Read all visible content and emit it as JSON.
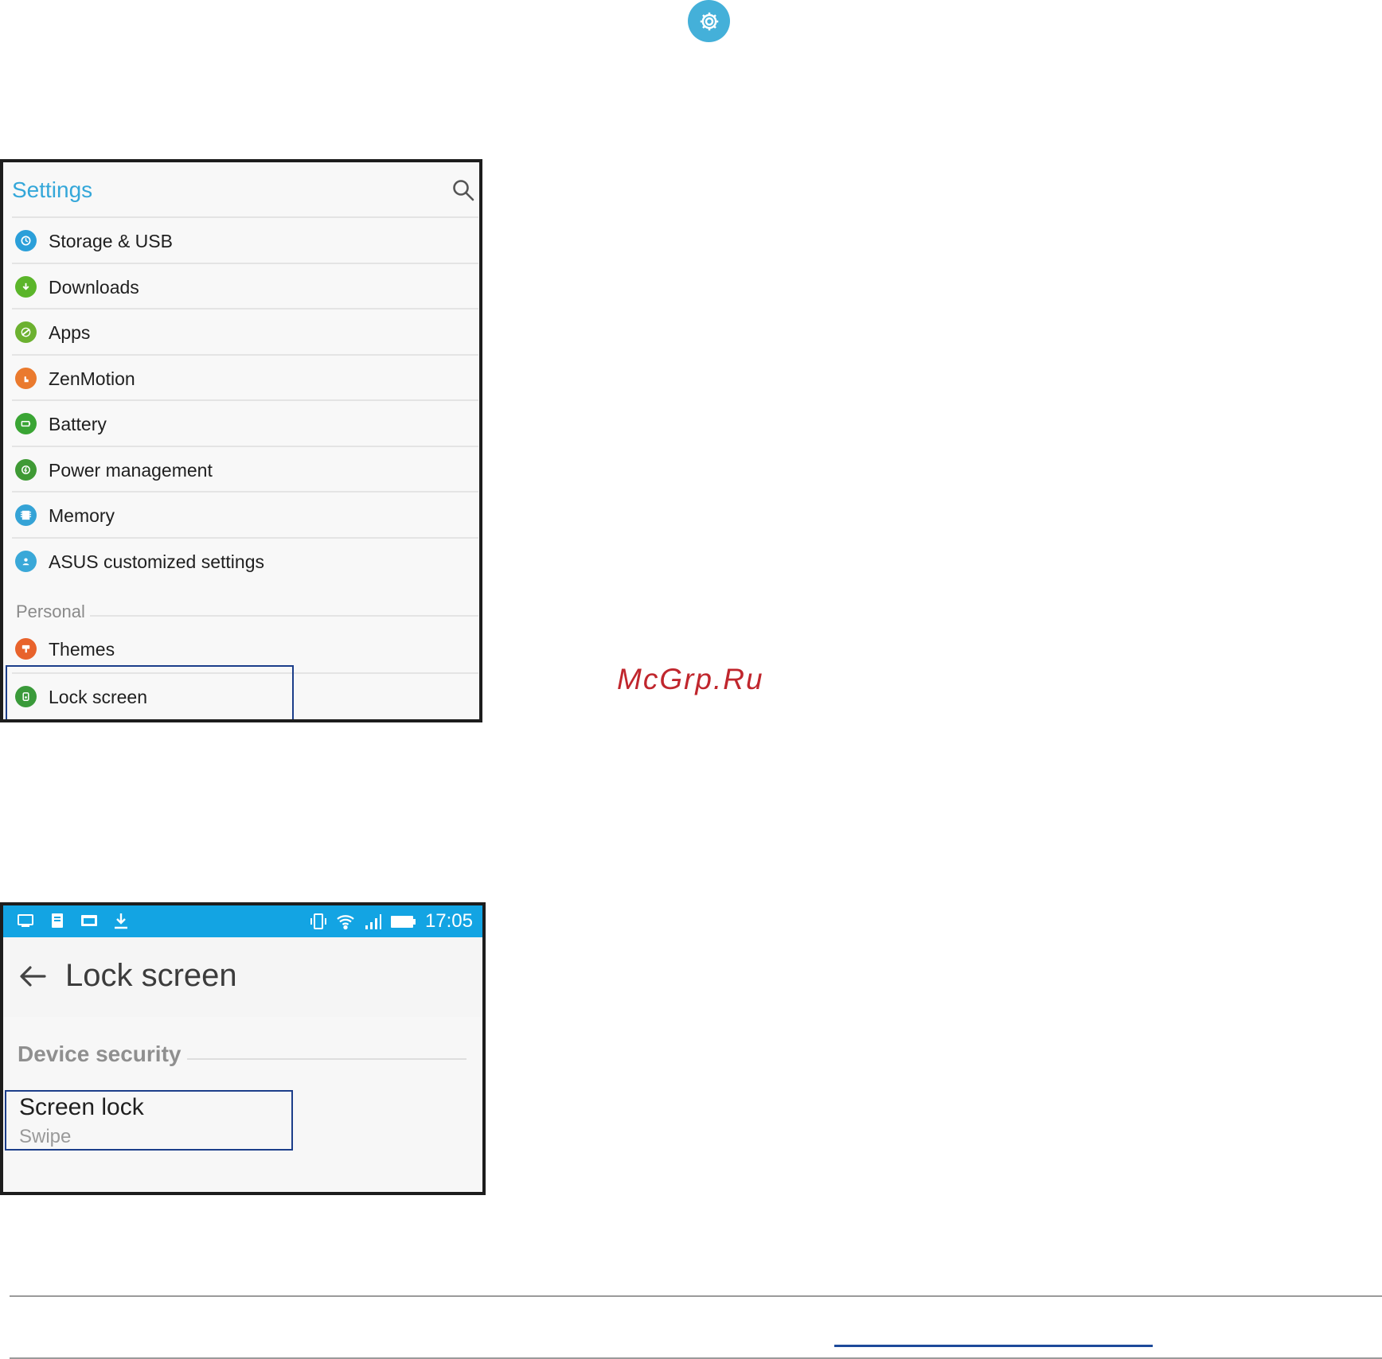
{
  "colors": {
    "accent": "#2ba8df",
    "gear_badge": "#44b0d9",
    "settings_title": "#34a7d9",
    "highlight_border": "#1c3e8a",
    "watermark": "#c0262d"
  },
  "top_icon": "gear-icon",
  "settings_screen": {
    "title": "Settings",
    "search_icon": "search-icon",
    "items": [
      {
        "label": "Storage & USB",
        "icon": "storage-icon",
        "color": "#2b9fd9"
      },
      {
        "label": "Downloads",
        "icon": "download-icon",
        "color": "#5bb52a"
      },
      {
        "label": "Apps",
        "icon": "apps-icon",
        "color": "#6cb130"
      },
      {
        "label": "ZenMotion",
        "icon": "zenmotion-icon",
        "color": "#ea7a2e"
      },
      {
        "label": "Battery",
        "icon": "battery-icon",
        "color": "#3aa534"
      },
      {
        "label": "Power management",
        "icon": "power-management-icon",
        "color": "#3f9a35"
      },
      {
        "label": "Memory",
        "icon": "memory-icon",
        "color": "#35a3d6"
      },
      {
        "label": "ASUS customized settings",
        "icon": "asus-settings-icon",
        "color": "#3aa8d8"
      }
    ],
    "section": "Personal",
    "personal_items": [
      {
        "label": "Themes",
        "icon": "themes-icon",
        "color": "#e8632c"
      },
      {
        "label": "Lock screen",
        "icon": "lock-screen-icon",
        "color": "#3a9a3a"
      }
    ]
  },
  "lock_screen": {
    "status_bar": {
      "time": "17:05",
      "left_icons": [
        "screen-cast-icon",
        "notes-icon",
        "gallery-icon",
        "download-icon"
      ],
      "right_icons": [
        "vibrate-icon",
        "wifi-icon",
        "signal-icon",
        "battery-icon"
      ],
      "color": "#13a4e3"
    },
    "title": "Lock screen",
    "back_icon": "back-arrow-icon",
    "section": "Device security",
    "item": {
      "primary": "Screen lock",
      "secondary": "Swipe"
    }
  },
  "watermark": "McGrp.Ru"
}
